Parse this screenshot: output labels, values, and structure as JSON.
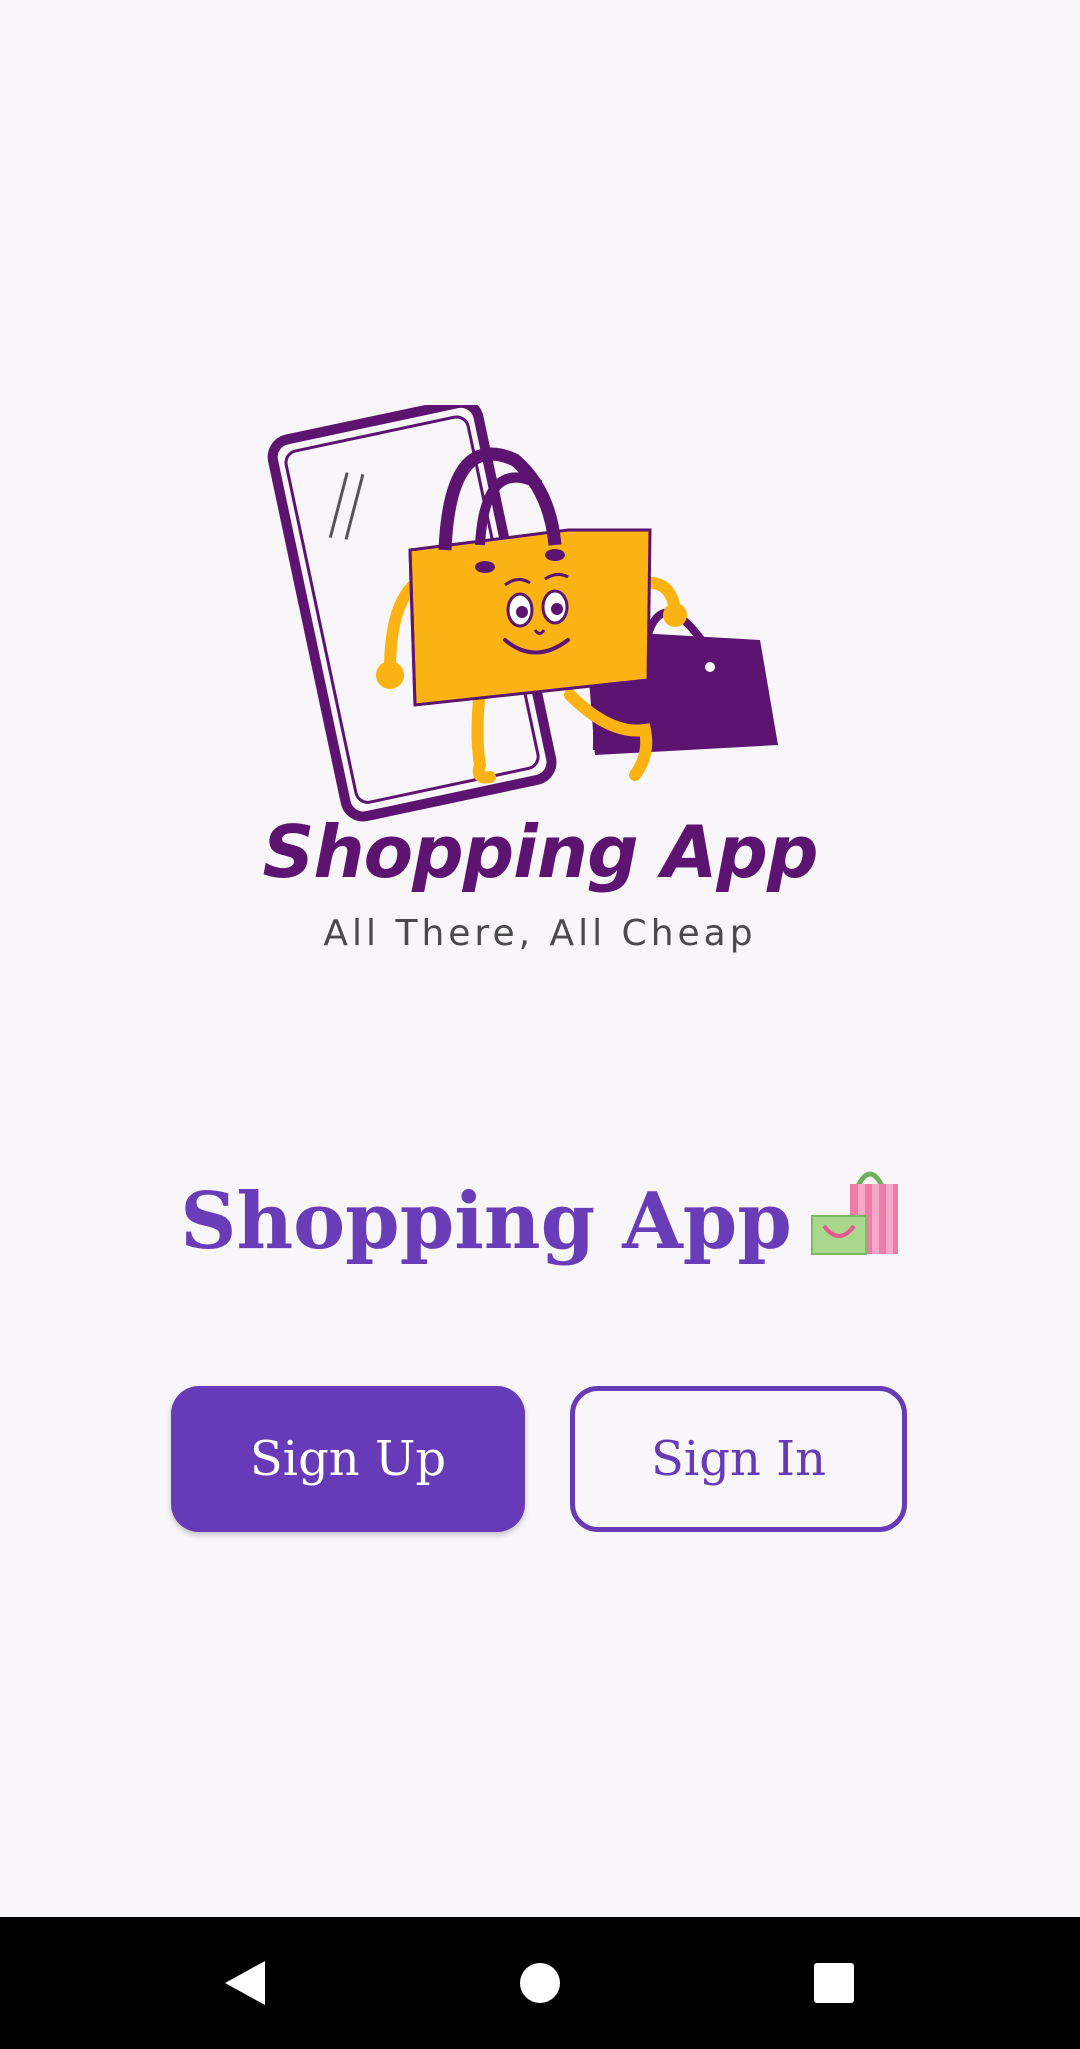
{
  "logo": {
    "title": "Shopping App",
    "tagline": "All There, All Cheap",
    "image": "shopping-bag-mascot-phone"
  },
  "app_title": "Shopping App",
  "title_icon": "shopping-bags-icon",
  "buttons": {
    "sign_up": "Sign Up",
    "sign_in": "Sign In"
  },
  "navbar": {
    "back": "back-icon",
    "home": "home-icon",
    "recent": "recent-apps-icon"
  },
  "colors": {
    "primary": "#673ab7",
    "logo_purple": "#5c1470",
    "logo_yellow": "#fbb314",
    "background": "#f8f6f8"
  }
}
